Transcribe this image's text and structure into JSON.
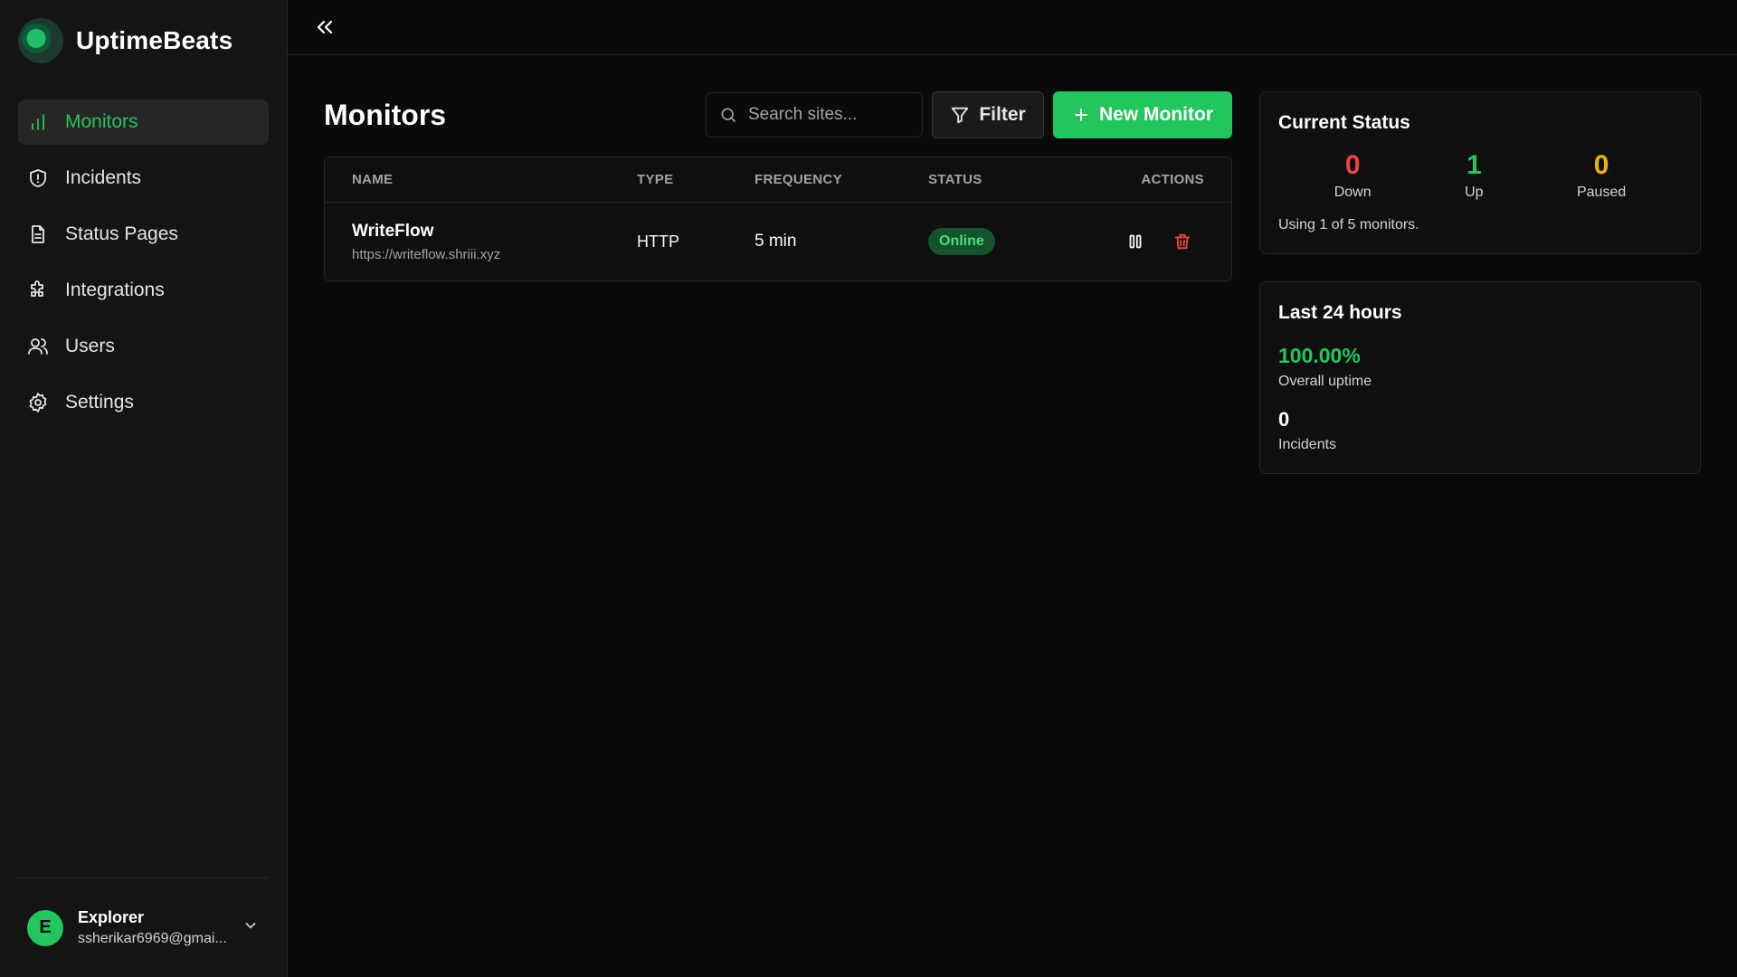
{
  "brand": {
    "name": "UptimeBeats"
  },
  "sidebar": {
    "items": [
      {
        "label": "Monitors",
        "icon": "bar-chart-icon",
        "active": true
      },
      {
        "label": "Incidents",
        "icon": "shield-icon"
      },
      {
        "label": "Status Pages",
        "icon": "document-icon"
      },
      {
        "label": "Integrations",
        "icon": "puzzle-icon"
      },
      {
        "label": "Users",
        "icon": "users-icon"
      },
      {
        "label": "Settings",
        "icon": "gear-icon"
      }
    ]
  },
  "user": {
    "initial": "E",
    "name": "Explorer",
    "email": "ssherikar6969@gmai..."
  },
  "main": {
    "title": "Monitors",
    "search_placeholder": "Search sites...",
    "filter_label": "Filter",
    "new_monitor_label": "New Monitor"
  },
  "table": {
    "columns": [
      "NAME",
      "TYPE",
      "FREQUENCY",
      "STATUS",
      "ACTIONS"
    ],
    "rows": [
      {
        "name": "WriteFlow",
        "url": "https://writeflow.shriii.xyz",
        "type": "HTTP",
        "frequency": "5 min",
        "status": "Online"
      }
    ]
  },
  "current_status": {
    "title": "Current Status",
    "down": {
      "value": "0",
      "label": "Down"
    },
    "up": {
      "value": "1",
      "label": "Up"
    },
    "paused": {
      "value": "0",
      "label": "Paused"
    },
    "usage": "Using 1 of 5 monitors."
  },
  "last24": {
    "title": "Last 24 hours",
    "uptime_value": "100.00%",
    "uptime_label": "Overall uptime",
    "incidents_value": "0",
    "incidents_label": "Incidents"
  },
  "colors": {
    "accent": "#22c55e",
    "danger": "#ef4444",
    "warning": "#eab308",
    "background": "#0a0a0a",
    "sidebar": "#141414"
  }
}
